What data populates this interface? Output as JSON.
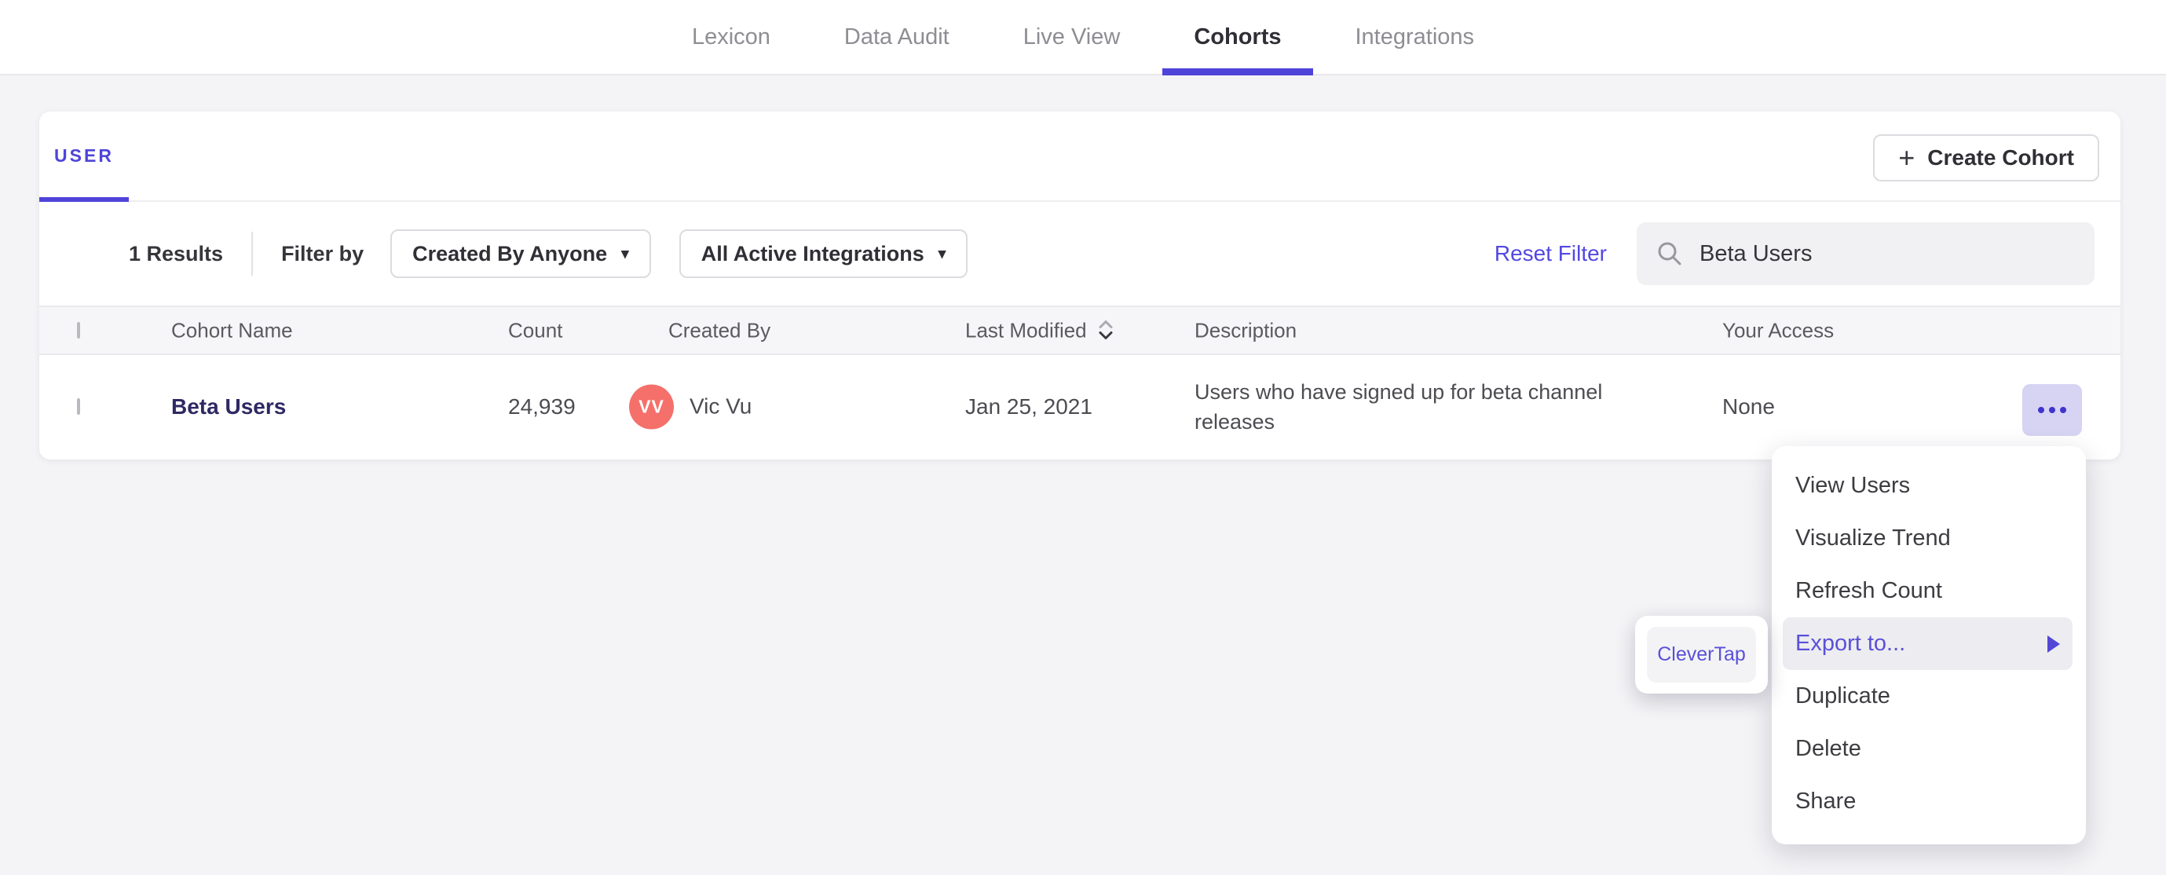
{
  "colors": {
    "accent_purple": "#4f44d9",
    "menu_highlight": "#ededf1",
    "avatar_coral": "#f5706b",
    "cohort_link_indigo": "#2e2963",
    "more_button_bg": "#d6d3f3"
  },
  "icons": {
    "plus_icon": "+",
    "caret_down_icon": "▾",
    "search_icon": "magnifier",
    "sort_icon": "up-down-chevrons",
    "more_icon": "three-rings",
    "submenu_arrow_icon": "right-triangle"
  },
  "nav": {
    "items": [
      {
        "label": "Lexicon",
        "active": false
      },
      {
        "label": "Data Audit",
        "active": false
      },
      {
        "label": "Live View",
        "active": false
      },
      {
        "label": "Cohorts",
        "active": true
      },
      {
        "label": "Integrations",
        "active": false
      }
    ]
  },
  "panel": {
    "tab": "USER",
    "create_button": "Create Cohort",
    "results_count": "1 Results",
    "filter_by_label": "Filter by",
    "created_by_filter": "Created By Anyone",
    "integrations_filter": "All Active Integrations",
    "reset_filter": "Reset Filter",
    "search_value": "Beta Users"
  },
  "table": {
    "columns": [
      "Cohort Name",
      "Count",
      "Created By",
      "Last Modified",
      "Description",
      "Your Access"
    ],
    "rows": [
      {
        "name": "Beta Users",
        "count": "24,939",
        "creator_initials": "VV",
        "creator": "Vic Vu",
        "last_modified": "Jan 25, 2021",
        "description": "Users who have signed up for beta channel releases",
        "access": "None"
      }
    ]
  },
  "context_menu": {
    "items": [
      "View Users",
      "Visualize Trend",
      "Refresh Count",
      "Export to...",
      "Duplicate",
      "Delete",
      "Share"
    ],
    "active_item": "Export to..."
  },
  "export_submenu": {
    "items": [
      "CleverTap"
    ]
  }
}
